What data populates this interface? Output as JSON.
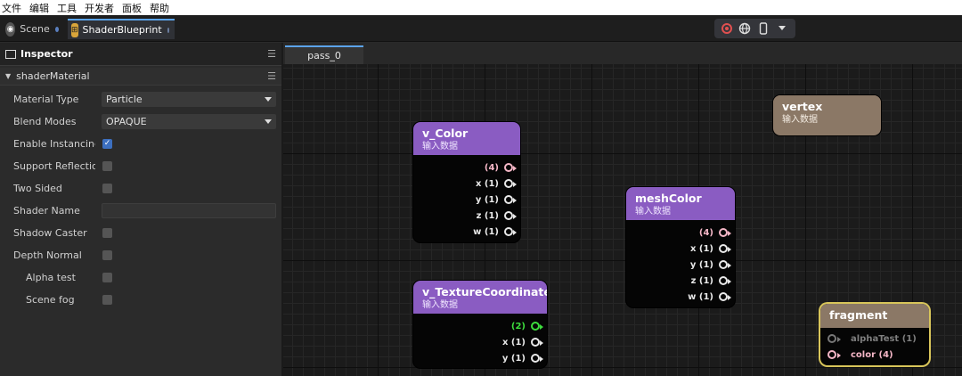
{
  "menu": [
    "文件",
    "编辑",
    "工具",
    "开发者",
    "面板",
    "帮助"
  ],
  "tabs": [
    {
      "label": "Scene"
    },
    {
      "label": "ShaderBlueprint"
    }
  ],
  "toolbar": {
    "record_icon": "record-icon",
    "globe_icon": "globe-icon",
    "phone_icon": "phone-icon",
    "dropdown_icon": "chevron-down-icon"
  },
  "inspector": {
    "title": "Inspector",
    "section": "shaderMaterial",
    "fields": {
      "material_type": {
        "label": "Material Type",
        "value": "Particle"
      },
      "blend_modes": {
        "label": "Blend Modes",
        "value": "OPAQUE"
      },
      "enable_instancing": {
        "label": "Enable Instancing",
        "checked": true
      },
      "support_reflection": {
        "label": "Support Reflection F",
        "checked": false
      },
      "two_sided": {
        "label": "Two Sided",
        "checked": false
      },
      "shader_name": {
        "label": "Shader Name",
        "value": ""
      },
      "shadow_caster": {
        "label": "Shadow Caster",
        "checked": false
      },
      "depth_normal": {
        "label": "Depth Normal",
        "checked": false
      },
      "alpha_test": {
        "label": "Alpha test",
        "checked": false
      },
      "scene_fog": {
        "label": "Scene fog",
        "checked": false
      }
    }
  },
  "canvas": {
    "pass_tab": "pass_0",
    "nodes": {
      "v_color": {
        "title": "v_Color",
        "subtitle": "输入数据",
        "outputs": [
          "(4)",
          "x (1)",
          "y (1)",
          "z (1)",
          "w (1)"
        ]
      },
      "v_texcoord": {
        "title": "v_TextureCoordinate",
        "subtitle": "输入数据",
        "outputs": [
          "(2)",
          "x (1)",
          "y (1)"
        ]
      },
      "mesh_color": {
        "title": "meshColor",
        "subtitle": "输入数据",
        "outputs": [
          "(4)",
          "x (1)",
          "y (1)",
          "z (1)",
          "w (1)"
        ]
      },
      "vertex": {
        "title": "vertex",
        "subtitle": "输入数据"
      },
      "fragment": {
        "title": "fragment",
        "inputs": [
          "alphaTest (1)",
          "color (4)"
        ]
      }
    }
  },
  "colors": {
    "accent": "#5ba3ea",
    "node_purple": "#8a5cc2",
    "node_tan": "#8b7866",
    "fragment_border": "#d8c55a"
  }
}
